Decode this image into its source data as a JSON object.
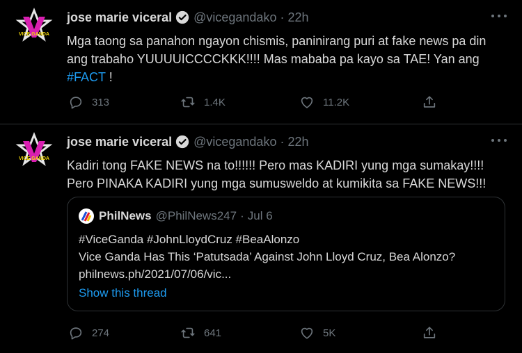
{
  "tweets": [
    {
      "name": "jose marie viceral",
      "handle": "@vicegandako",
      "separator": "·",
      "time": "22h",
      "text_line1": "Mga taong sa panahon ngayon chismis, paninirang puri at fake news pa din",
      "text_line2": "ang trabaho YUUUUICCCCKKK!!!! Mas mababa pa kayo sa TAE!  Yan ang",
      "hashtag": "#FACT",
      "text_end": " !",
      "replies": "313",
      "retweets": "1.4K",
      "likes": "11.2K"
    },
    {
      "name": "jose marie viceral",
      "handle": "@vicegandako",
      "separator": "·",
      "time": "22h",
      "text_line1": "Kadiri tong FAKE NEWS na to!!!!!! Pero mas KADIRI yung mga sumakay!!!!",
      "text_line2": "Pero PINAKA KADIRI yung mga sumusweldo at kumikita sa FAKE NEWS!!!",
      "quote": {
        "name": "PhilNews",
        "handle": "@PhilNews247",
        "separator": "·",
        "date": "Jul 6",
        "line1": "#ViceGanda #JohnLloydCruz #BeaAlonzo",
        "line2": "Vice Ganda Has This ‘Patutsada’ Against John Lloyd Cruz, Bea Alonzo?",
        "line3": "philnews.ph/2021/07/06/vic...",
        "show_thread": "Show this thread"
      },
      "replies": "274",
      "retweets": "641",
      "likes": "5K"
    }
  ],
  "icons": {
    "reply": "reply-icon",
    "retweet": "retweet-icon",
    "like": "heart-icon",
    "share": "share-icon",
    "verified": "verified-badge-icon",
    "more": "more-options-icon"
  },
  "colors": {
    "background": "#000000",
    "text": "#d9d9d9",
    "muted": "#6e767d",
    "link": "#1d9bf0",
    "border": "#2f3336"
  },
  "avatar": {
    "logo_text": "VICE GANDA"
  }
}
